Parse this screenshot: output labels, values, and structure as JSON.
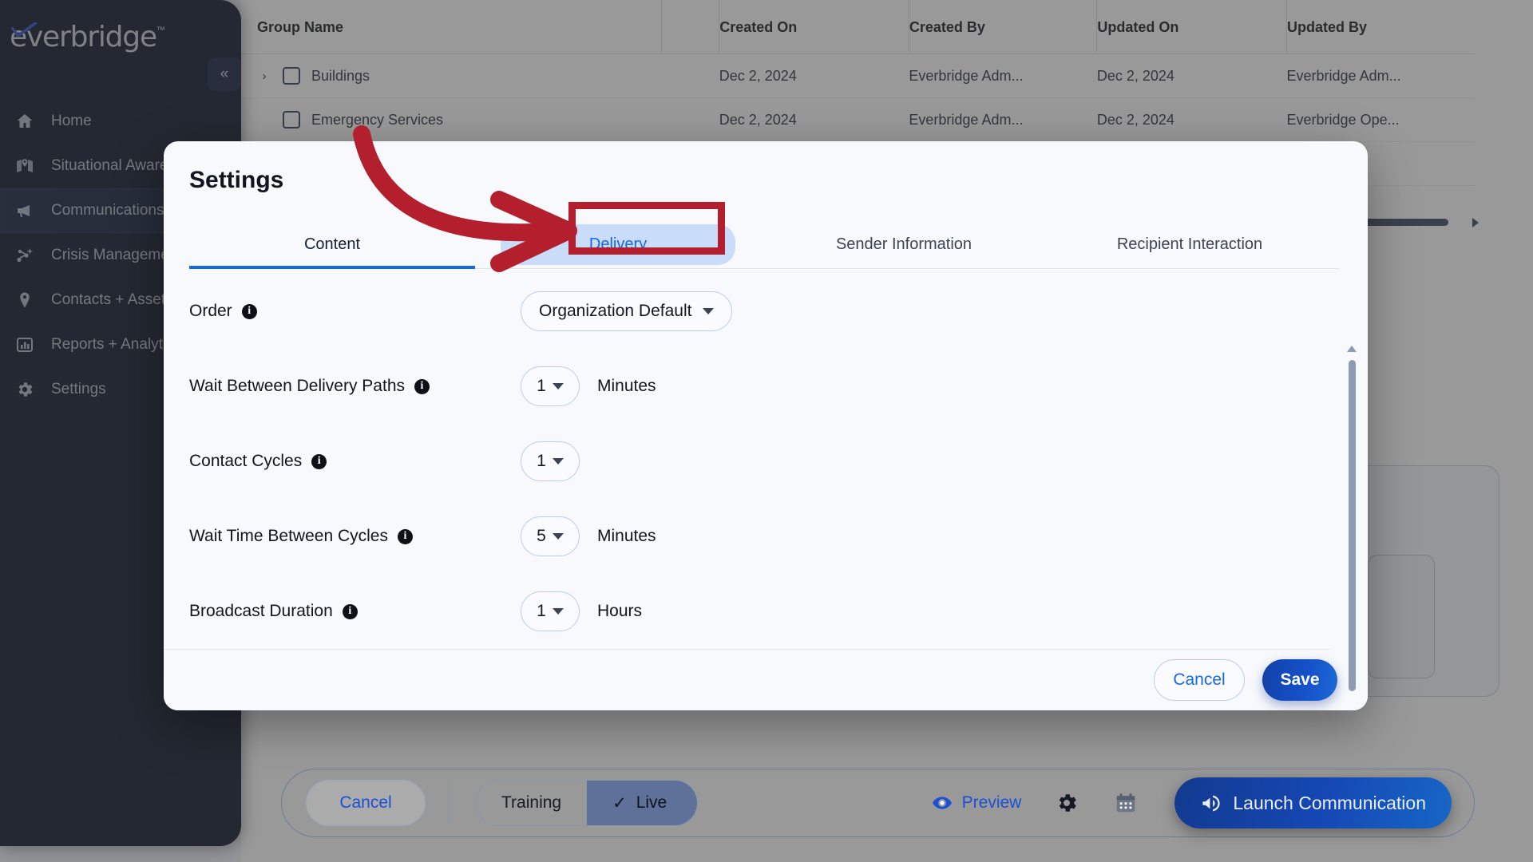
{
  "sidebar": {
    "brand": "everbridge",
    "trademark": "™",
    "collapse_label": "«",
    "items": [
      {
        "label": "Home",
        "icon": "home-icon",
        "active": false
      },
      {
        "label": "Situational Awareness",
        "icon": "map-pin-icon",
        "active": false
      },
      {
        "label": "Communications",
        "icon": "megaphone-icon",
        "active": true
      },
      {
        "label": "Crisis Management",
        "icon": "crisis-network-icon",
        "active": false
      },
      {
        "label": "Contacts + Assets",
        "icon": "location-pin-icon",
        "active": false
      },
      {
        "label": "Reports + Analytics",
        "icon": "bar-chart-icon",
        "active": false
      },
      {
        "label": "Settings",
        "icon": "gear-icon",
        "active": false
      }
    ]
  },
  "table": {
    "columns": [
      "Group Name",
      "Created On",
      "Created By",
      "Updated On",
      "Updated By"
    ],
    "rows": [
      {
        "name": "Buildings",
        "expandable": true,
        "created_on": "Dec 2, 2024",
        "created_by": "Everbridge Adm...",
        "updated_on": "Dec 2, 2024",
        "updated_by": "Everbridge Adm..."
      },
      {
        "name": "Emergency Services",
        "expandable": false,
        "created_on": "Dec 2, 2024",
        "created_by": "Everbridge Adm...",
        "updated_on": "Dec 2, 2024",
        "updated_by": "Everbridge Ope..."
      }
    ]
  },
  "modal": {
    "title": "Settings",
    "tabs": [
      {
        "label": "Content",
        "state": "active"
      },
      {
        "label": "Delivery",
        "state": "highlighted"
      },
      {
        "label": "Sender Information",
        "state": "normal"
      },
      {
        "label": "Recipient Interaction",
        "state": "normal"
      }
    ],
    "fields": [
      {
        "label": "Order",
        "info": "i",
        "value": "Organization Default",
        "unit": "",
        "kind": "wide"
      },
      {
        "label": "Wait Between Delivery Paths",
        "info": "i",
        "value": "1",
        "unit": "Minutes",
        "kind": "narrow"
      },
      {
        "label": "Contact Cycles",
        "info": "i",
        "value": "1",
        "unit": "",
        "kind": "narrow"
      },
      {
        "label": "Wait Time Between Cycles",
        "info": "i",
        "value": "5",
        "unit": "Minutes",
        "kind": "narrow"
      },
      {
        "label": "Broadcast Duration",
        "info": "i",
        "value": "1",
        "unit": "Hours",
        "kind": "narrow"
      }
    ],
    "cancel_label": "Cancel",
    "save_label": "Save"
  },
  "bottom_bar": {
    "cancel_label": "Cancel",
    "mode_training": "Training",
    "mode_live": "Live",
    "live_check": "✓",
    "preview_label": "Preview",
    "launch_label": "Launch Communication"
  },
  "colors": {
    "accent_blue": "#1668e3",
    "sidebar_bg": "#0a1428",
    "annotation_red": "#b41f2e",
    "tab_highlight": "#c9ddfb"
  }
}
